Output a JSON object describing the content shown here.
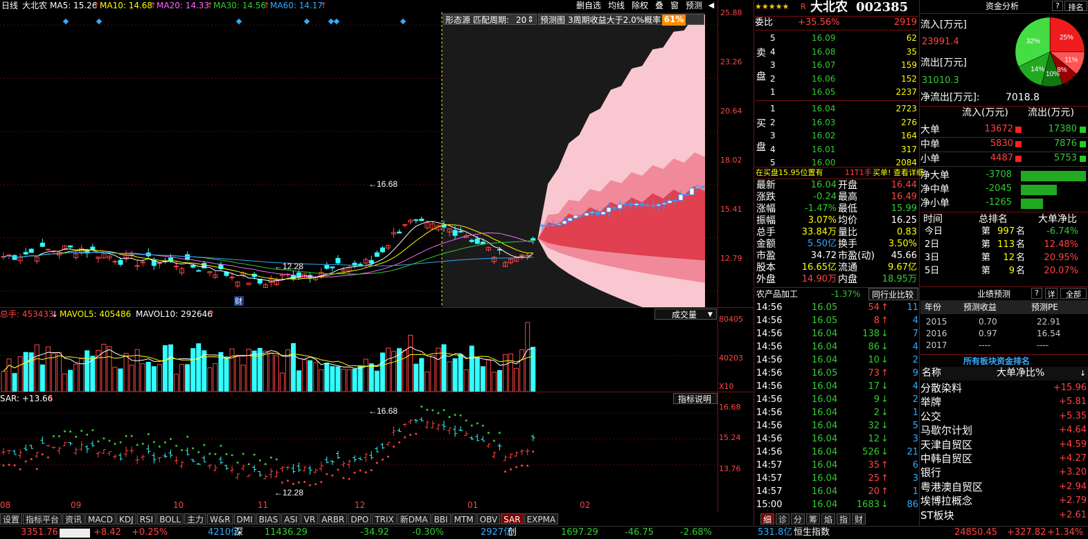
{
  "header": {
    "period": "日线",
    "name": "大北农",
    "ma": [
      {
        "label": "MA5: 15.26",
        "color": "#ffffff"
      },
      {
        "label": "MA10: 14.68",
        "color": "#ffff00"
      },
      {
        "label": "MA20: 14.33",
        "color": "#ff66ff"
      },
      {
        "label": "MA30: 14.56",
        "color": "#33cc33"
      },
      {
        "label": "MA60: 14.17",
        "color": "#33aaff"
      }
    ],
    "toolbar": [
      "删自选",
      "均线",
      "除权",
      "叠",
      "窗",
      "预测"
    ]
  },
  "price_axis": [
    "25.88",
    "23.26",
    "20.64",
    "18.02",
    "15.41",
    "12.79"
  ],
  "chart_labels": {
    "high": "16.68",
    "low": "12.28",
    "cai": "财"
  },
  "pattern": {
    "source": "形态源",
    "period_label": "匹配周期:",
    "period_value": "20",
    "forecast": "预测图",
    "desc": "3周期收益大于2.0%概率",
    "prob": "61%"
  },
  "volume": {
    "total": "总手: 453433",
    "mavol5": "MAVOL5: 405486",
    "mavol10": "MAVOL10: 292646",
    "selector": "成交量",
    "axis": [
      "80405",
      "40203"
    ],
    "unit": "X10"
  },
  "sar": {
    "label": "SAR: +13.66",
    "explain": "指标说明",
    "axis": [
      "16.68",
      "15.24",
      "13.76"
    ],
    "high": "16.68",
    "low": "12.28"
  },
  "months": [
    "08",
    "09",
    "10",
    "11",
    "12",
    "01",
    "02"
  ],
  "bottom_tabs": [
    "设置",
    "指标平台",
    "资讯",
    "MACD",
    "KDJ",
    "RSI",
    "BOLL",
    "主力",
    "W&R",
    "DMI",
    "BIAS",
    "ASI",
    "VR",
    "ARBR",
    "DPO",
    "TRIX",
    "新DMA",
    "BBI",
    "MTM",
    "OBV",
    "SAR",
    "EXPMA"
  ],
  "active_tab": "SAR",
  "ticker": [
    {
      "text": "3351.76",
      "color": "#ff4444"
    },
    {
      "text": "+8.42",
      "color": "#ff4444"
    },
    {
      "text": "+0.25%",
      "color": "#ff4444"
    },
    {
      "text": "4210亿",
      "color": "#33aaff"
    },
    {
      "text": "深",
      "color": "#ffffff"
    },
    {
      "text": "11436.29",
      "color": "#33cc33"
    },
    {
      "text": "-34.92",
      "color": "#33cc33"
    },
    {
      "text": "-0.30%",
      "color": "#33cc33"
    },
    {
      "text": "2927亿",
      "color": "#33aaff"
    },
    {
      "text": "创",
      "color": "#ffffff"
    },
    {
      "text": "1697.29",
      "color": "#33cc33"
    },
    {
      "text": "-46.75",
      "color": "#33cc33"
    },
    {
      "text": "-2.68%",
      "color": "#33cc33"
    },
    {
      "text": "531.8亿",
      "color": "#33aaff"
    },
    {
      "text": "恒生指数",
      "color": "#ffffff"
    },
    {
      "text": "24850.45",
      "color": "#ff4444"
    },
    {
      "text": "+327.82",
      "color": "#ff4444"
    },
    {
      "text": "+1.34%",
      "color": "#ff4444"
    }
  ],
  "quote": {
    "stars": "★★★★★",
    "r": "R",
    "name": "大北农",
    "code": "002385",
    "weibi_label": "委比",
    "weibi": "+35.56%",
    "weicha": "2919",
    "sell_label": [
      "卖",
      "盘"
    ],
    "buy_label": [
      "买",
      "盘"
    ],
    "sells": [
      {
        "n": "5",
        "p": "16.09",
        "v": "62"
      },
      {
        "n": "4",
        "p": "16.08",
        "v": "35"
      },
      {
        "n": "3",
        "p": "16.07",
        "v": "159"
      },
      {
        "n": "2",
        "p": "16.06",
        "v": "152"
      },
      {
        "n": "1",
        "p": "16.05",
        "v": "2237"
      }
    ],
    "buys": [
      {
        "n": "1",
        "p": "16.04",
        "v": "2723"
      },
      {
        "n": "2",
        "p": "16.03",
        "v": "276"
      },
      {
        "n": "3",
        "p": "16.02",
        "v": "164"
      },
      {
        "n": "4",
        "p": "16.01",
        "v": "317"
      },
      {
        "n": "5",
        "p": "16.00",
        "v": "2084"
      }
    ],
    "notice": "在买盘15.95位置有",
    "notice2": "11T1手",
    "notice3": "买单!",
    "notice4": "查看详细",
    "stats": [
      {
        "l1": "最新",
        "v1": "16.04",
        "c1": "#33cc33",
        "l2": "开盘",
        "v2": "16.44",
        "c2": "#ff4444"
      },
      {
        "l1": "涨跌",
        "v1": "-0.24",
        "c1": "#33cc33",
        "l2": "最高",
        "v2": "16.49",
        "c2": "#ff4444"
      },
      {
        "l1": "涨幅",
        "v1": "-1.47%",
        "c1": "#33cc33",
        "l2": "最低",
        "v2": "15.99",
        "c2": "#33cc33"
      },
      {
        "l1": "振幅",
        "v1": "3.07%",
        "c1": "#ffff00",
        "l2": "均价",
        "v2": "16.25",
        "c2": "#ffffff"
      },
      {
        "l1": "总手",
        "v1": "33.84万",
        "c1": "#ffff00",
        "l2": "量比",
        "v2": "0.83",
        "c2": "#ffff00"
      },
      {
        "l1": "金额",
        "v1": "5.50亿",
        "c1": "#33aaff",
        "l2": "换手",
        "v2": "3.50%",
        "c2": "#ffff00"
      },
      {
        "l1": "市盈",
        "v1": "34.72",
        "c1": "#ffffff",
        "l2": "市盈(动)",
        "v2": "45.66",
        "c2": "#ffffff"
      },
      {
        "l1": "股本",
        "v1": "16.65亿",
        "c1": "#ffff00",
        "l2": "流通",
        "v2": "9.67亿",
        "c2": "#ffff00"
      },
      {
        "l1": "外盘",
        "v1": "14.90万",
        "c1": "#ff4444",
        "l2": "内盘",
        "v2": "18.95万",
        "c2": "#33cc33"
      }
    ],
    "industry": "农产品加工",
    "industry_chg": "-1.37%",
    "compare": "同行业比较",
    "ticks": [
      {
        "t": "14:56",
        "p": "16.05",
        "v": "54",
        "d": "up",
        "n": "11"
      },
      {
        "t": "14:56",
        "p": "16.05",
        "v": "8",
        "d": "up",
        "n": "4"
      },
      {
        "t": "14:56",
        "p": "16.04",
        "v": "138",
        "d": "down",
        "n": "7"
      },
      {
        "t": "14:56",
        "p": "16.04",
        "v": "86",
        "d": "down",
        "n": "4"
      },
      {
        "t": "14:56",
        "p": "16.04",
        "v": "10",
        "d": "down",
        "n": "2"
      },
      {
        "t": "14:56",
        "p": "16.05",
        "v": "73",
        "d": "up",
        "n": "9"
      },
      {
        "t": "14:56",
        "p": "16.04",
        "v": "17",
        "d": "down",
        "n": "4"
      },
      {
        "t": "14:56",
        "p": "16.04",
        "v": "9",
        "d": "down",
        "n": "2"
      },
      {
        "t": "14:56",
        "p": "16.04",
        "v": "2",
        "d": "down",
        "n": "1"
      },
      {
        "t": "14:56",
        "p": "16.04",
        "v": "32",
        "d": "down",
        "n": "5"
      },
      {
        "t": "14:56",
        "p": "16.04",
        "v": "12",
        "d": "down",
        "n": "3"
      },
      {
        "t": "14:56",
        "p": "16.04",
        "v": "526",
        "d": "down",
        "n": "21"
      },
      {
        "t": "14:57",
        "p": "16.04",
        "v": "35",
        "d": "up",
        "n": "6"
      },
      {
        "t": "14:57",
        "p": "16.04",
        "v": "25",
        "d": "up",
        "n": "3"
      },
      {
        "t": "14:57",
        "p": "16.04",
        "v": "20",
        "d": "up",
        "n": "1"
      },
      {
        "t": "15:00",
        "p": "16.04",
        "v": "1683",
        "d": "down",
        "n": "86"
      }
    ],
    "bottom_tabs": [
      "细",
      "诊",
      "分",
      "筹",
      "焰",
      "指",
      "财"
    ]
  },
  "capital": {
    "title": "资金分析",
    "help": "?",
    "rank": "排名",
    "inflow_label": "流入[万元]",
    "inflow": "23991.4",
    "outflow_label": "流出[万元]",
    "outflow": "31010.3",
    "net_label": "净流出[万元]:",
    "net": "7018.8",
    "pie": [
      {
        "label": "25%",
        "value": 25,
        "color": "#ee1c1c"
      },
      {
        "label": "11%",
        "value": 11,
        "color": "#ff5555"
      },
      {
        "label": "8%",
        "value": 8,
        "color": "#990000"
      },
      {
        "label": "10%",
        "value": 10,
        "color": "#117711"
      },
      {
        "label": "14%",
        "value": 14,
        "color": "#22aa22"
      },
      {
        "label": "32%",
        "value": 32,
        "color": "#44dd44"
      }
    ],
    "cols": [
      "流入(万元)",
      "流出(万元)"
    ],
    "rows": [
      {
        "l": "大单",
        "in": "13672",
        "out": "17380"
      },
      {
        "l": "中单",
        "in": "5830",
        "out": "7876"
      },
      {
        "l": "小单",
        "in": "4487",
        "out": "5753"
      }
    ],
    "nets": [
      {
        "l": "净大单",
        "v": "-3708",
        "frac": 1.0
      },
      {
        "l": "净中单",
        "v": "-2045",
        "frac": 0.55
      },
      {
        "l": "净小单",
        "v": "-1265",
        "frac": 0.34
      }
    ],
    "rank_head": [
      "时间",
      "总排名",
      "大单净比"
    ],
    "ranks": [
      {
        "d": "今日",
        "r": "997",
        "p": "-6.74%",
        "c": "#33cc33"
      },
      {
        "d": "2日",
        "r": "113",
        "p": "12.48%",
        "c": "#ff4444"
      },
      {
        "d": "3日",
        "r": "12",
        "p": "20.95%",
        "c": "#ff4444"
      },
      {
        "d": "5日",
        "r": "9",
        "p": "20.07%",
        "c": "#ff4444"
      }
    ],
    "rank_di": "第",
    "rank_ming": "名",
    "forecast_title": "业绩预测",
    "forecast_help": "?",
    "forecast_detail": "详",
    "forecast_full": "全部",
    "forecast_head": [
      "年份",
      "预测收益",
      "预测PE"
    ],
    "forecast": [
      {
        "y": "2015",
        "e": "0.70",
        "pe": "22.91"
      },
      {
        "y": "2016",
        "e": "0.97",
        "pe": "16.54"
      },
      {
        "y": "2017",
        "e": "----",
        "pe": "----"
      }
    ],
    "sector_title": "所有板块资金排名",
    "sector_head": [
      "名称",
      "大单净比%"
    ],
    "sectors": [
      {
        "n": "分散染料",
        "v": "+15.96"
      },
      {
        "n": "举牌",
        "v": "+5.81"
      },
      {
        "n": "公交",
        "v": "+5.35"
      },
      {
        "n": "马歇尔计划",
        "v": "+4.64"
      },
      {
        "n": "天津自贸区",
        "v": "+4.59"
      },
      {
        "n": "中韩自贸区",
        "v": "+4.27"
      },
      {
        "n": "银行",
        "v": "+3.20"
      },
      {
        "n": "粤港澳自贸区",
        "v": "+2.94"
      },
      {
        "n": "埃博拉概念",
        "v": "+2.79"
      },
      {
        "n": "ST板块",
        "v": "+2.61"
      }
    ]
  },
  "colors": {
    "up": "#ff4444",
    "down": "#33cc33",
    "vol_up": "#ff4444",
    "vol_down": "#33ffff",
    "accent": "#ffff00",
    "blue": "#33aaff"
  }
}
